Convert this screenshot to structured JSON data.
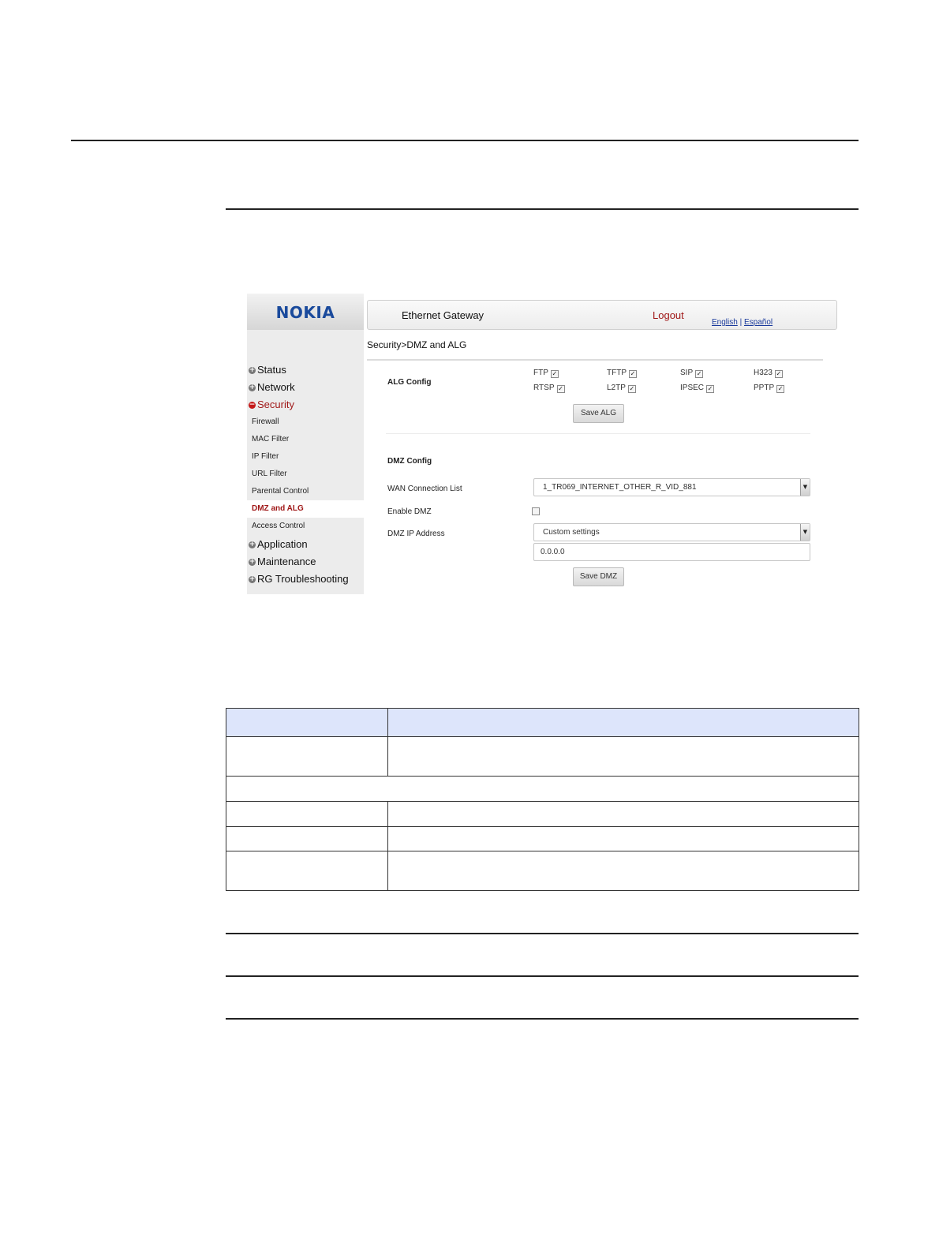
{
  "app": {
    "logo": "NOKIA",
    "title": "Ethernet Gateway",
    "logout_label": "Logout",
    "lang_english": "English",
    "lang_separator": "|",
    "lang_espanol": "Español"
  },
  "sidebar": {
    "items": [
      {
        "label": "Status",
        "expanded": false
      },
      {
        "label": "Network",
        "expanded": false
      },
      {
        "label": "Security",
        "expanded": true
      },
      {
        "label": "Application",
        "expanded": false
      },
      {
        "label": "Maintenance",
        "expanded": false
      },
      {
        "label": "RG Troubleshooting",
        "expanded": false
      }
    ],
    "security_sub": [
      "Firewall",
      "MAC Filter",
      "IP Filter",
      "URL Filter",
      "Parental Control",
      "DMZ and ALG",
      "Access Control"
    ],
    "active_sub": "DMZ and ALG"
  },
  "breadcrumb": "Security>DMZ and ALG",
  "alg": {
    "section_label": "ALG Config",
    "protocols": [
      {
        "name": "FTP",
        "checked": true
      },
      {
        "name": "TFTP",
        "checked": true
      },
      {
        "name": "SIP",
        "checked": true
      },
      {
        "name": "H323",
        "checked": true
      },
      {
        "name": "RTSP",
        "checked": true
      },
      {
        "name": "L2TP",
        "checked": true
      },
      {
        "name": "IPSEC",
        "checked": true
      },
      {
        "name": "PPTP",
        "checked": true
      }
    ],
    "save_label": "Save ALG"
  },
  "dmz": {
    "section_label": "DMZ Config",
    "wan_label": "WAN Connection List",
    "wan_value": "1_TR069_INTERNET_OTHER_R_VID_881",
    "enable_label": "Enable DMZ",
    "enabled": false,
    "ip_label": "DMZ IP Address",
    "ip_mode": "Custom settings",
    "ip_value": "0.0.0.0",
    "save_label": "Save DMZ"
  },
  "colors": {
    "brand_blue": "#1a4a9c",
    "accent_red": "#a01818",
    "table_header": "#dde5fb"
  }
}
